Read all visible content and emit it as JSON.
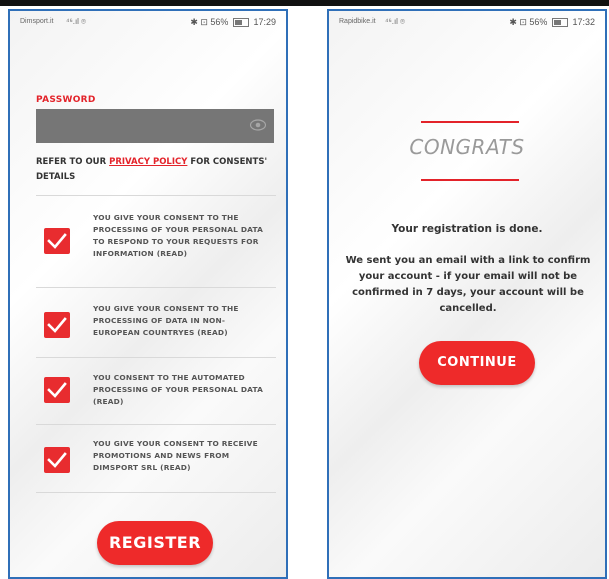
{
  "left_phone": {
    "status": {
      "carrier": "Dimsport.it",
      "signal": "⁴⁶.ıl ⌾",
      "info": "✱ ⊡ 56%",
      "time": "17:29"
    },
    "password_label": "PASSWORD",
    "policy": {
      "prefix": "REFER TO OUR ",
      "link": "PRIVACY POLICY",
      "suffix": " FOR CONSENTS' DETAILS"
    },
    "consents": [
      {
        "text": "YOU GIVE YOUR CONSENT TO THE PROCESSING OF YOUR PERSONAL DATA TO RESPOND TO YOUR REQUESTS FOR INFORMATION (READ)",
        "checked": true
      },
      {
        "text": "YOU GIVE YOUR CONSENT TO THE PROCESSING OF DATA IN NON-EUROPEAN COUNTRYES (READ)",
        "checked": true
      },
      {
        "text": "YOU CONSENT TO THE AUTOMATED PROCESSING OF YOUR PERSONAL DATA (READ)",
        "checked": true
      },
      {
        "text": "YOU GIVE YOUR CONSENT TO RECEIVE PROMOTIONS AND NEWS FROM DIMSPORT SRL (READ)",
        "checked": true
      }
    ],
    "register_label": "REGISTER"
  },
  "right_phone": {
    "status": {
      "carrier": "Rapidbike.it",
      "signal": "⁴⁶.ıl ⌾",
      "info": "✱ ⊡ 56%",
      "time": "17:32"
    },
    "congrats": "CONGRATS",
    "done": "Your registration is done.",
    "message": "We sent you an email with a link to confirm your account - if your email will not be confirmed in 7 days, your account will be cancelled.",
    "continue_label": "CONTINUE"
  },
  "colors": {
    "accent": "#e3232a",
    "button": "#ee2a2a",
    "field": "#767676"
  }
}
